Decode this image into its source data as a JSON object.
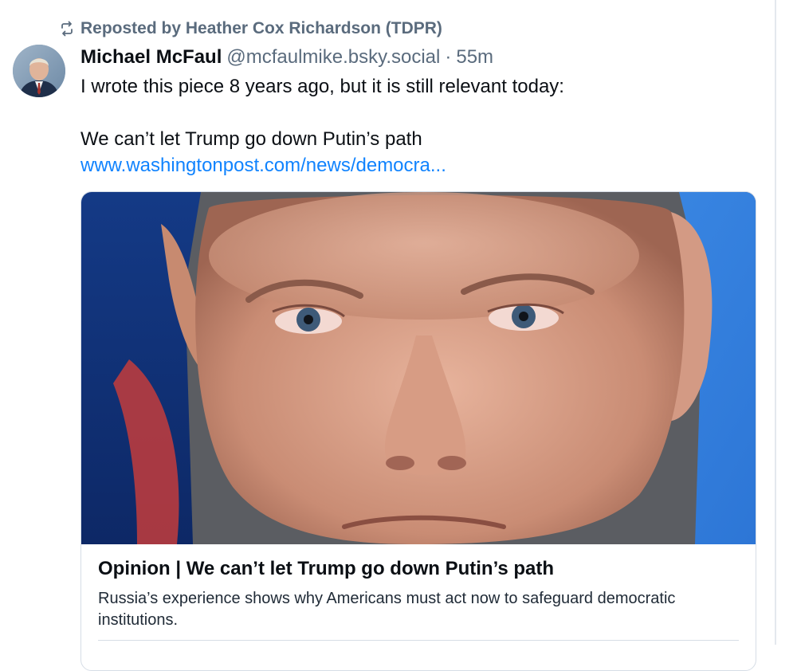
{
  "repost": {
    "icon": "repost-icon",
    "label": "Reposted by Heather Cox Richardson (TDPR)"
  },
  "post": {
    "author_name": "Michael McFaul",
    "author_handle": "@mcfaulmike.bsky.social",
    "separator": "·",
    "time": "55m",
    "text_line1": "I wrote this piece 8 years ago, but it is still relevant today:",
    "text_line2": "We can’t let Trump go down Putin’s path",
    "link_text": "www.washingtonpost.com/news/democra..."
  },
  "card": {
    "title": "Opinion | We can’t let Trump go down Putin’s path",
    "description": "Russia’s experience shows why Americans must act now to safeguard democratic institutions."
  },
  "colors": {
    "link": "#1083fe",
    "muted_text": "#5a6b7d",
    "border": "#d6dde6"
  }
}
